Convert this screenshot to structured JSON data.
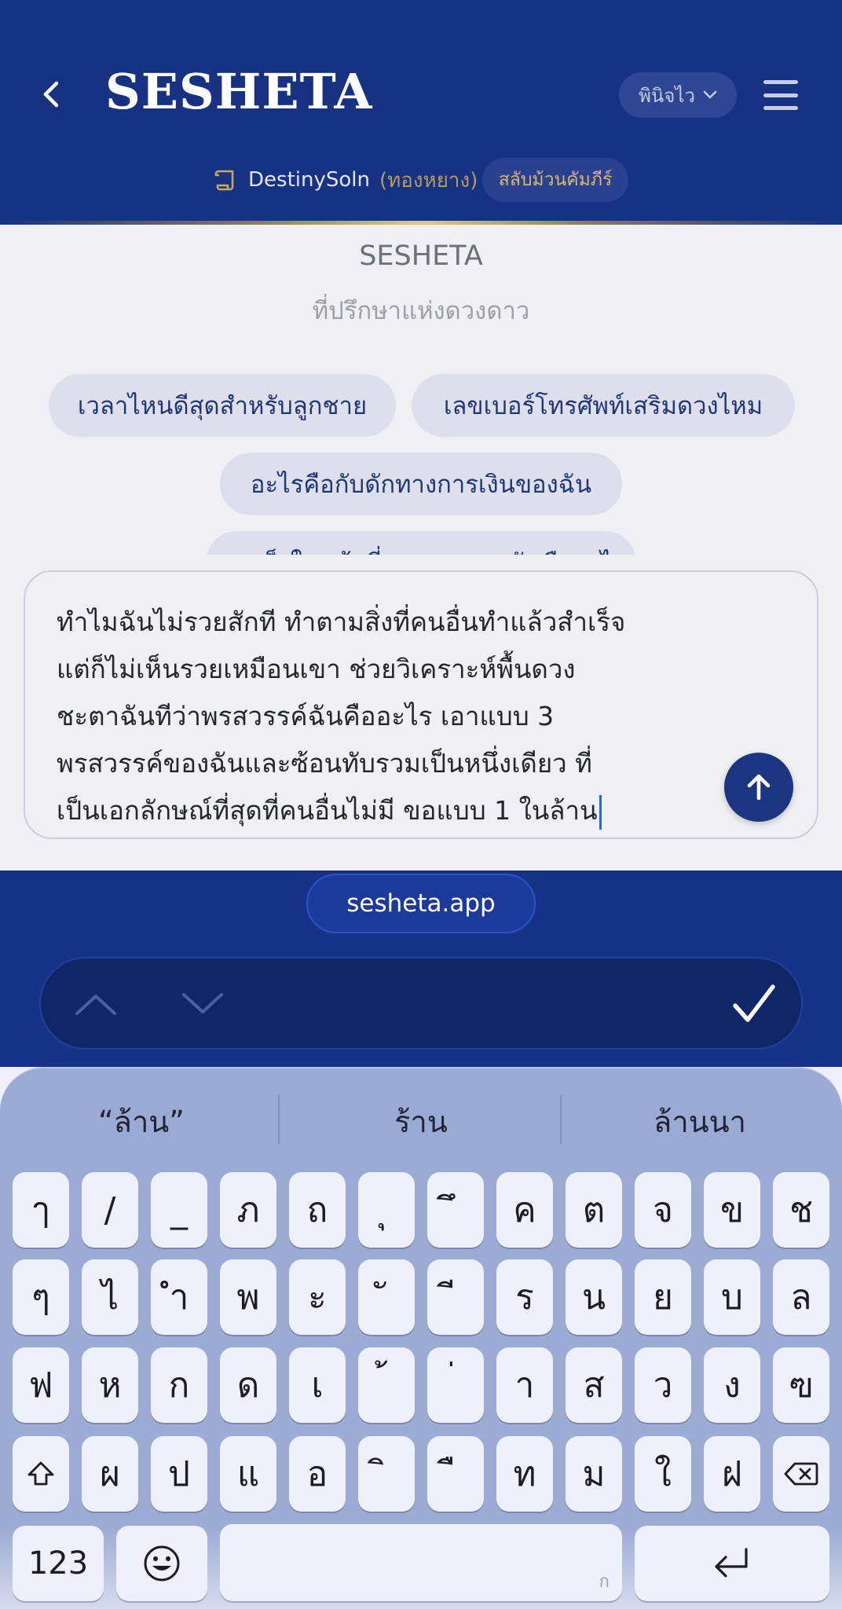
{
  "header": {
    "brand": "SESHETA",
    "language": "พินิจไว",
    "account_name": "DestinySoln",
    "account_tier": "(ทองหยาง)",
    "swap_label": "สลับม้วนคัมภีร์"
  },
  "chat": {
    "title": "SESHETA",
    "subtitle": "ที่ปรึกษาแห่งดวงดาว",
    "suggestions": [
      "เวลาไหนดีสุดสำหรับลูกชาย",
      "เลขเบอร์โทรศัพท์เสริมดวงไหม",
      "อะไรคือกับดักทางการเงินของฉัน",
      "จุดแข็งในหน้าที่การงานของฉันคืออะไร"
    ]
  },
  "composer": {
    "lines": [
      "ทำไมฉันไม่รวยสักที ทำตามสิ่งที่คนอื่นทำแล้วสำเร็จ",
      "แต่ก็ไม่เห็นรวยเหมือนเขา ช่วยวิเคราะห์พื้นดวง",
      "ชะตาฉันทีว่าพรสวรรค์ฉันคืออะไร เอาแบบ 3",
      "พรสวรรค์ของฉันและซ้อนทับรวมเป็นหนึ่งเดียว ที่",
      "เป็นเอกลักษณ์ที่สุดที่คนอื่นไม่มี ขอแบบ 1 ในล้าน"
    ]
  },
  "browser": {
    "url": "sesheta.app"
  },
  "keyboard": {
    "suggestions": [
      "“ล้าน”",
      "ร้าน",
      "ล้านนา"
    ],
    "row1": [
      "ๅ",
      "/",
      "_",
      "ภ",
      "ถ",
      "ุ",
      "ึ",
      "ค",
      "ต",
      "จ",
      "ข",
      "ช"
    ],
    "row2": [
      "ๆ",
      "ไ",
      "ำ",
      "พ",
      "ะ",
      "ั",
      "ี",
      "ร",
      "น",
      "ย",
      "บ",
      "ล"
    ],
    "row3": [
      "ฟ",
      "ห",
      "ก",
      "ด",
      "เ",
      "้",
      "่",
      "า",
      "ส",
      "ว",
      "ง",
      "ฃ"
    ],
    "row4": [
      "ผ",
      "ป",
      "แ",
      "อ",
      "ิ",
      "ื",
      "ท",
      "ม",
      "ใ",
      "ฝ"
    ],
    "numbers_label": "123",
    "space_hint": "ก"
  },
  "colors": {
    "header_bg": "#173283",
    "accent_gold": "#d8b86d",
    "send_button": "#1c3581",
    "keyboard_bg": "#9aaad4"
  }
}
